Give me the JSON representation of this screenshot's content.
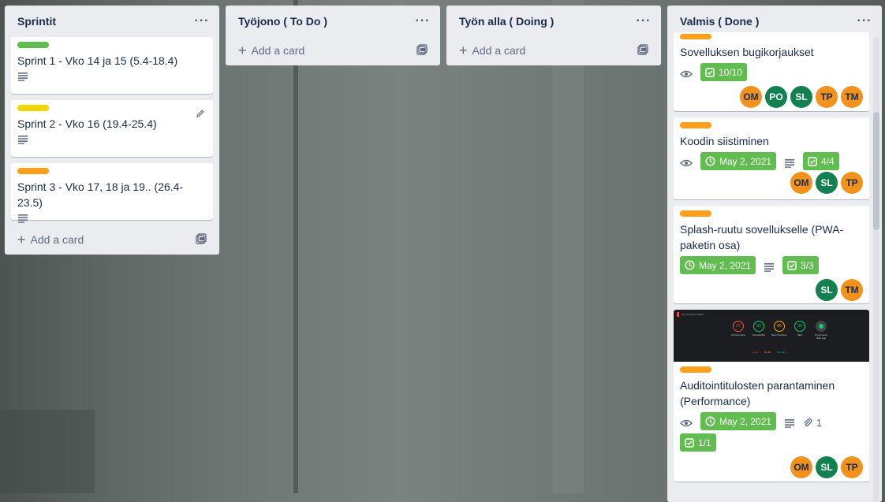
{
  "colors": {
    "label_green": "#61bd4f",
    "label_yellow": "#f2d600",
    "label_orange": "#ff9f1a",
    "badge_green": "#61bd4f",
    "avatar_orange": "#f2921d",
    "avatar_green": "#128051"
  },
  "lists": [
    {
      "title": "Sprintit",
      "add_card": "Add a card",
      "cards": [
        {
          "label": "green",
          "title": "Sprint 1 - Vko 14 ja 15 (5.4-18.4)"
        },
        {
          "label": "yellow",
          "title": "Sprint 2 - Vko 16 (19.4-25.4)"
        },
        {
          "label": "orange",
          "title": "Sprint 3 - Vko 17, 18 ja 19.. (26.4-23.5)"
        }
      ]
    },
    {
      "title": "Työjono ( To Do )",
      "add_card": "Add a card",
      "cards": []
    },
    {
      "title": "Työn alla ( Doing )",
      "add_card": "Add a card",
      "cards": []
    },
    {
      "title": "Valmis ( Done )",
      "cards": [
        {
          "title": "Sovelluksen bugikorjaukset",
          "checklist": "10/10",
          "members": [
            "OM",
            "PO",
            "SL",
            "TP",
            "TM"
          ]
        },
        {
          "title": "Koodin siistiminen",
          "due": "May 2, 2021",
          "checklist": "4/4",
          "members": [
            "OM",
            "SL",
            "TP"
          ]
        },
        {
          "title": "Splash-ruutu sovellukselle (PWA-paketin osa)",
          "due": "May 2, 2021",
          "checklist": "3/3",
          "members": [
            "SL",
            "TM"
          ]
        },
        {
          "title": "Auditointitulosten parantaminen (Performance)",
          "due": "May 2, 2021",
          "attachments": "1",
          "checklist": "1/1",
          "members": [
            "OM",
            "SL",
            "TP"
          ],
          "cover": {
            "header": "http://localhost:3000/",
            "scores": [
              {
                "value": "27",
                "name": "Performance",
                "color": "#ff4e42"
              },
              {
                "value": "93",
                "name": "Accessibility",
                "color": "#0cce6b"
              },
              {
                "value": "80",
                "name": "Best Practices",
                "color": "#ffa400"
              },
              {
                "value": "90",
                "name": "SEO",
                "color": "#0cce6b"
              },
              {
                "value": "",
                "name": "Progressive Web App",
                "color": "#888888"
              }
            ],
            "legend": [
              "0–49",
              "50–89",
              "90–100"
            ]
          }
        }
      ]
    }
  ]
}
